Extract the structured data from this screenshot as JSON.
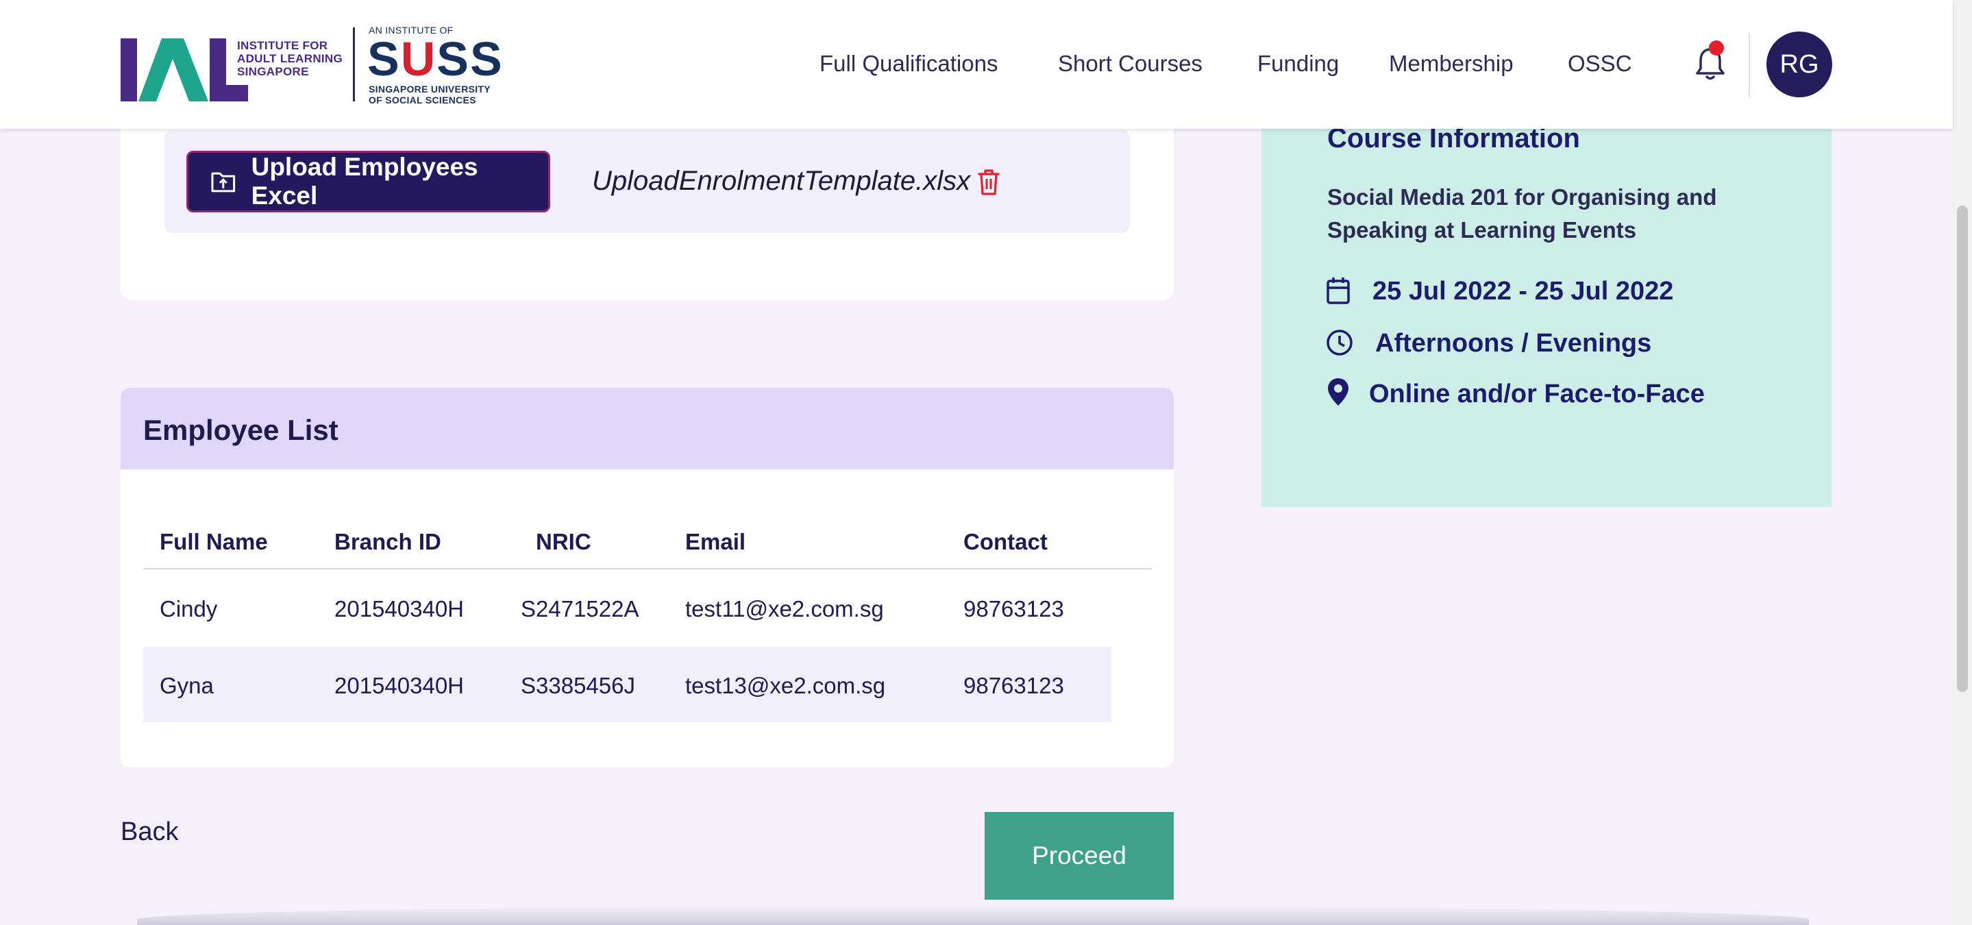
{
  "header": {
    "ial_logo_text": "IAL",
    "ial_name": "INSTITUTE FOR ADULT LEARNING SINGAPORE",
    "suss_top": "AN INSTITUTE OF",
    "suss_word_a": "S",
    "suss_word_b": "U",
    "suss_word_c": "SS",
    "suss_sub": "SINGAPORE UNIVERSITY OF SOCIAL SCIENCES",
    "nav": [
      "Full Qualifications",
      "Short Courses",
      "Funding",
      "Membership",
      "OSSC"
    ],
    "avatar_initials": "RG"
  },
  "upload": {
    "button_label": "Upload Employees Excel",
    "filename": "UploadEnrolmentTemplate.xlsx"
  },
  "employees": {
    "title": "Employee List",
    "columns": [
      "Full Name",
      "Branch ID",
      "NRIC",
      "Email",
      "Contact"
    ],
    "rows": [
      [
        "Cindy",
        "201540340H",
        "S2471522A",
        "test11@xe2.com.sg",
        "98763123"
      ],
      [
        "Gyna",
        "201540340H",
        "S3385456J",
        "test13@xe2.com.sg",
        "98763123"
      ]
    ]
  },
  "actions": {
    "back_label": "Back",
    "proceed_label": "Proceed"
  },
  "course": {
    "title": "Course Information",
    "name": "Social Media 201 for Organising and Speaking at Learning Events",
    "date": "25 Jul 2022 - 25 Jul 2022",
    "time": "Afternoons / Evenings",
    "mode": "Online and/or Face-to-Face"
  },
  "icons": {
    "upload": "upload-folder-icon",
    "delete": "trash-icon",
    "calendar": "calendar-icon",
    "clock": "clock-icon",
    "location": "location-pin-icon",
    "bell": "bell-icon"
  },
  "colors": {
    "brand_dark": "#25185c",
    "proceed": "#3fa18c",
    "course_bg": "#cdeee7",
    "list_header": "#e0d7f8",
    "page_bg": "#f5f0fc",
    "alert": "#e3202c"
  }
}
